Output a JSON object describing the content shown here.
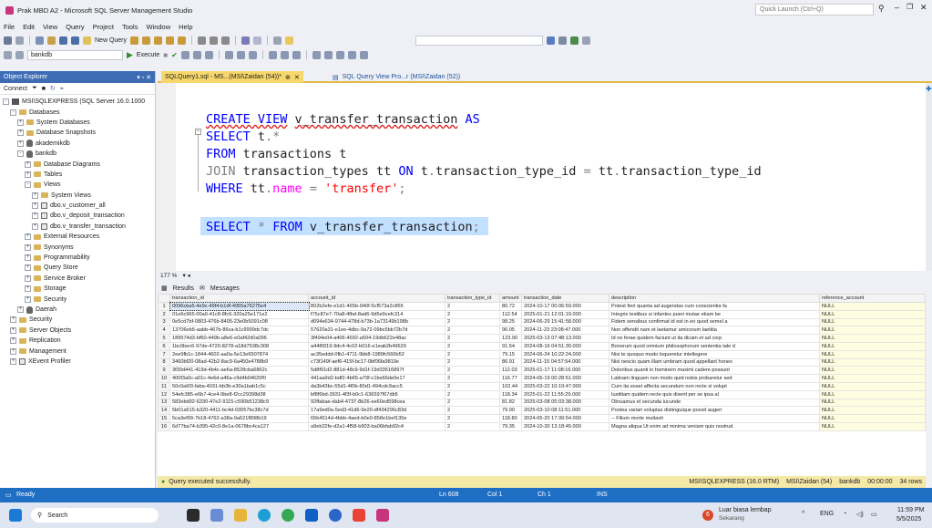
{
  "window": {
    "title": "Prak MBD A2 - Microsoft SQL Server Management Studio",
    "quick_launch": "Quick Launch (Ctrl+Q)"
  },
  "menu": [
    "File",
    "Edit",
    "View",
    "Query",
    "Project",
    "Tools",
    "Window",
    "Help"
  ],
  "toolbar": {
    "new_query": "New Query",
    "execute": "Execute",
    "database": "bankdb"
  },
  "object_explorer": {
    "title": "Object Explorer",
    "connect": "Connect",
    "items": [
      {
        "label": "MSI\\SQLEXPRESS (SQL Server 16.0.1000",
        "level": 0,
        "exp": "-",
        "icon": "server-icon"
      },
      {
        "label": "Databases",
        "level": 1,
        "exp": "-",
        "icon": "folder-icon"
      },
      {
        "label": "System Databases",
        "level": 2,
        "exp": "+",
        "icon": "folder-icon"
      },
      {
        "label": "Database Snapshots",
        "level": 2,
        "exp": "+",
        "icon": "folder-icon"
      },
      {
        "label": "akademikdb",
        "level": 2,
        "exp": "+",
        "icon": "database-icon"
      },
      {
        "label": "bankdb",
        "level": 2,
        "exp": "-",
        "icon": "database-icon"
      },
      {
        "label": "Database Diagrams",
        "level": 3,
        "exp": "+",
        "icon": "folder-icon"
      },
      {
        "label": "Tables",
        "level": 3,
        "exp": "+",
        "icon": "folder-icon"
      },
      {
        "label": "Views",
        "level": 3,
        "exp": "-",
        "icon": "folder-icon"
      },
      {
        "label": "System Views",
        "level": 4,
        "exp": "+",
        "icon": "folder-icon"
      },
      {
        "label": "dbo.v_customer_all",
        "level": 4,
        "exp": "+",
        "icon": "view-icon"
      },
      {
        "label": "dbo.v_deposit_transaction",
        "level": 4,
        "exp": "+",
        "icon": "view-icon"
      },
      {
        "label": "dbo.v_transfer_transaction",
        "level": 4,
        "exp": "+",
        "icon": "view-icon"
      },
      {
        "label": "External Resources",
        "level": 3,
        "exp": "+",
        "icon": "folder-icon"
      },
      {
        "label": "Synonyms",
        "level": 3,
        "exp": "+",
        "icon": "folder-icon"
      },
      {
        "label": "Programmability",
        "level": 3,
        "exp": "+",
        "icon": "folder-icon"
      },
      {
        "label": "Query Store",
        "level": 3,
        "exp": "+",
        "icon": "folder-icon"
      },
      {
        "label": "Service Broker",
        "level": 3,
        "exp": "+",
        "icon": "folder-icon"
      },
      {
        "label": "Storage",
        "level": 3,
        "exp": "+",
        "icon": "folder-icon"
      },
      {
        "label": "Security",
        "level": 3,
        "exp": "+",
        "icon": "folder-icon"
      },
      {
        "label": "Daerah",
        "level": 2,
        "exp": "+",
        "icon": "database-icon"
      },
      {
        "label": "Security",
        "level": 1,
        "exp": "+",
        "icon": "folder-icon"
      },
      {
        "label": "Server Objects",
        "level": 1,
        "exp": "+",
        "icon": "folder-icon"
      },
      {
        "label": "Replication",
        "level": 1,
        "exp": "+",
        "icon": "folder-icon"
      },
      {
        "label": "Management",
        "level": 1,
        "exp": "+",
        "icon": "folder-icon"
      },
      {
        "label": "XEvent Profiler",
        "level": 1,
        "exp": "+",
        "icon": "profiler-icon"
      }
    ]
  },
  "tabs": [
    {
      "label": "SQLQuery1.sql - MS...(MSI\\Zaidan (54))*",
      "active": true
    },
    {
      "label": "SQL Query View Pro...r (MSI\\Zaidan (52))",
      "active": false
    }
  ],
  "editor": {
    "zoom": "177 %"
  },
  "results": {
    "tab_results": "Results",
    "tab_messages": "Messages",
    "columns": [
      "",
      "transaction_id",
      "account_id",
      "transaction_type_id",
      "amount",
      "transaction_date",
      "description",
      "reference_account"
    ],
    "rows": [
      [
        "1",
        "0096cba5-4e9c-49f4-b1df-4955a76275e4",
        "802b2efe-e1d1-465b-940f-5cf573a2c865",
        "2",
        "80.72",
        "2024-10-17 00:06:59.000",
        "Potest fieri quanta ad augendas cum conscientia fa",
        "NULL"
      ],
      [
        "2",
        "01e6c965-00a0-41c8-8fc6-320a25e171e2",
        "f75c87e7-70a8-4fbd-8ad6-9d5e9cefc314",
        "2",
        "112.54",
        "2025-01-21 12:01:19.000",
        "Integris testibus si infantes pueri mutae etiam be",
        "NULL"
      ],
      [
        "3",
        "0e5cd7bf-0803-476b-8405-23e0b5091c08",
        "d094e634-9744-478d-b73b-1a73149b198b",
        "2",
        "98.25",
        "2024-06-29 15:41:58.000",
        "Fidem sensibus confirmat id est in eo quod semel a",
        "NULL"
      ],
      [
        "4",
        "13706eb5-aabb-467b-86ca-b1c9999dc7dc",
        "57620a31-e1ee-4dbc-9a72-09bc5bb72b7d",
        "2",
        "96.05",
        "2024-11-23 23:08:47.000",
        "Non offendit nam et laetamur amicorum laetitia",
        "NULL"
      ],
      [
        "5",
        "189574d3-bf60-449b-a8e6-e0af42d0a096",
        "3f494e04-a406-4692-a504-19db622e48ac",
        "2",
        "123.90",
        "2025-03-13 07:48:13.000",
        "Id ne ferae quidem faciunt ut ita dicam et ad corp",
        "NULL"
      ],
      [
        "6",
        "1bc0bec6-97de-4720-8278-a18d7538c308",
        "a448f319-9dc4-4c02-b016-e1eab2b49629",
        "2",
        "91.54",
        "2024-08-16 04:51:30.000",
        "Bonorum quod omnium philosophorum sententia tale d",
        "NULL"
      ],
      [
        "7",
        "2ee9fb1c-1844-4602-aa0a-5e13e6507874",
        "ac35eddd-0fb1-4711-9bb8-1989fc566b52",
        "2",
        "79.15",
        "2024-06-24 10:22:24.000",
        "Nisi te quoquo modo loqueretur intellegere",
        "NULL"
      ],
      [
        "8",
        "3460bf20-08ad-42b2-8ac9-6a450e4788b9",
        "c73f149f-aef6-415f-bc17-0bf06fa9819e",
        "2",
        "86.91",
        "2024-11-15 04:57:54.000",
        "Nisi nescio quam illam umbram quod appellant hones",
        "NULL"
      ],
      [
        "9",
        "3f30d441-419d-4b4c-ae6a-8528cba6862c",
        "5d8f91d2-881d-48c9-9d1f-19d33516897f",
        "2",
        "112.03",
        "2025-01-17 11:08:16.000",
        "Doloribus quanti in hominem maximi cadere possunt",
        "NULL"
      ],
      [
        "10",
        "400f3a0c-a01c-4e6d-a46a-c9d4b04620f0",
        "441aa9d2-bdf2-4b65-a79f-c1be66de0e17",
        "2",
        "116.77",
        "2024-06-19 00:28:51.000",
        "Latinam linguam non modo quid nobis probaretur sed",
        "NULL"
      ],
      [
        "11",
        "50c0a6f3-faba-4031-bb3b-e30a1bab1c5c",
        "da3b43bc-55d1-4f0b-80d1-494cdc9acc5",
        "2",
        "102.44",
        "2025-03-22 10:19:47.000",
        "Cum ita esset affecta secundum non recte si volupt",
        "NULL"
      ],
      [
        "12",
        "54efc385-e6b7-4ce4-9be8-f2cc29398d38",
        "bf8f6bd-3931-4f3f-b0c1-636597f67db5",
        "2",
        "118.34",
        "2025-01-22 11:55:29.000",
        "Iustitiam quidem recte quis dixerit per se ipsa al",
        "NULL"
      ],
      [
        "13",
        "583ebd92-6330-47e2-9115-c590b51238c9",
        "92ffabae-dab4-4737-8b26-ee60ed598cea",
        "2",
        "81.82",
        "2025-03-08 05:03:38.000",
        "Obruamus et secunda iucunde",
        "NULL"
      ],
      [
        "14",
        "5b01a515-b320-4411-bc4d-03057bc38c7d",
        "17a9ed0a-5ed3-41d6-9e20-df434296c83d",
        "2",
        "79.90",
        "2025-03-10 08:11:51.000",
        "Postea variari voluptas distinguique possit augeri",
        "NULL"
      ],
      [
        "15",
        "5ca3ef09-7b18-4762-a38a-9a621f898b19",
        "65b4514d-4bbb-4aed-b0e0-858e1bef135e",
        "2",
        "118.80",
        "2024-05-20 17:39:54.000",
        "-- Filium morte multavit",
        "NULL"
      ],
      [
        "16",
        "6d77ba74-b395-42c0-8e1a-0678bc4ca127",
        "a9eb22fe-d2a1-4f58-b903-ba06bfab92c4",
        "2",
        "79.35",
        "2024-10-30 13:18:45.000",
        "Magna aliqua Ut enim ad minima veniam quis nostrud",
        "NULL"
      ]
    ]
  },
  "query_status": {
    "message": "Query executed successfully.",
    "server": "MSI\\SQLEXPRESS (16.0 RTM)",
    "user": "MSI\\Zaidan (54)",
    "db": "bankdb",
    "time": "00:00:00",
    "rows": "34 rows"
  },
  "statusbar": {
    "ready": "Ready",
    "ln": "Ln 608",
    "col": "Col 1",
    "ch": "Ch 1",
    "ins": "INS"
  },
  "taskbar": {
    "search": "Search",
    "weather_title": "Luar biasa lembap",
    "weather_sub": "Sekarang",
    "lang": "ENG",
    "time": "11:59 PM",
    "date": "5/5/2025",
    "badge": "6"
  },
  "colors": {
    "accent": "#3e6db5",
    "status_blue": "#1e6fc4",
    "tab_gold": "#e6b94a",
    "keyword": "#0000ff",
    "string": "#ff0000"
  }
}
